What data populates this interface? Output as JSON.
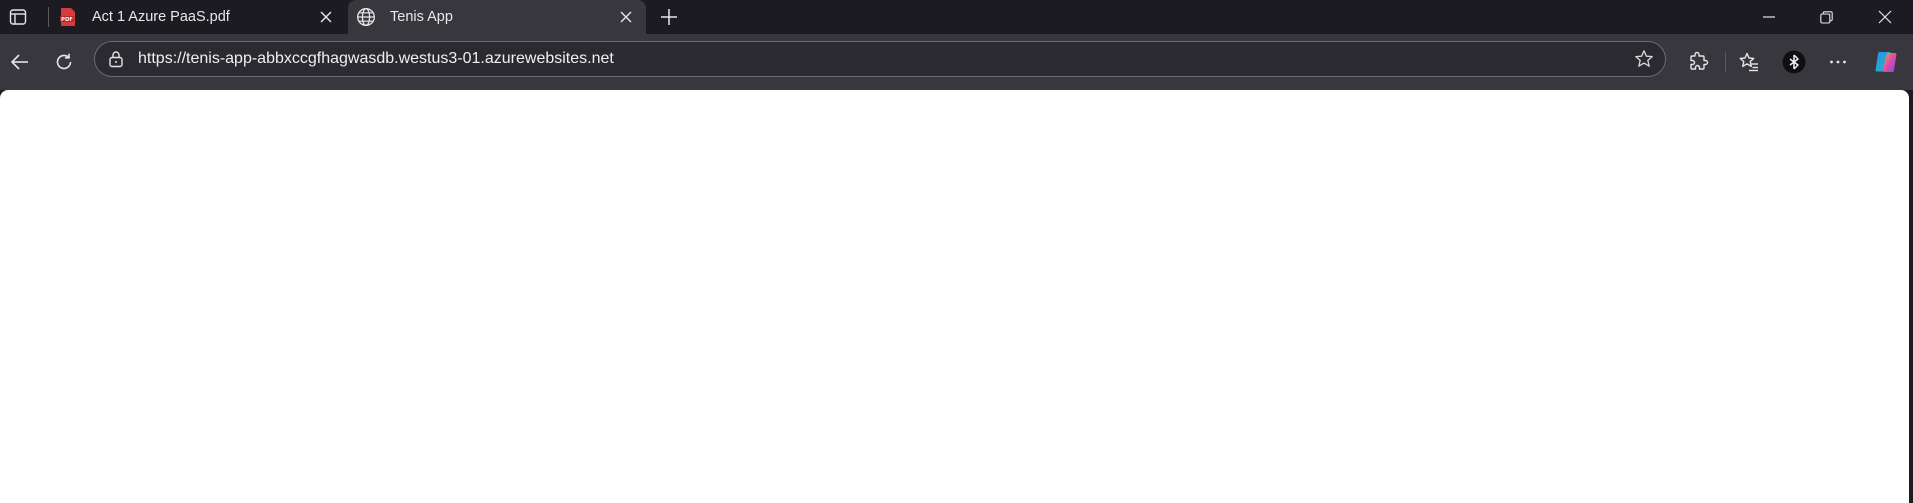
{
  "browser": {
    "tabs": [
      {
        "title": "Act 1 Azure PaaS.pdf",
        "icon": "pdf-icon",
        "active": false
      },
      {
        "title": "Tenis App",
        "icon": "globe-icon",
        "active": true
      }
    ],
    "address_bar": {
      "url": "https://tenis-app-abbxccgfhagwasdb.westus3-01.azurewebsites.net"
    },
    "toolbar_icons": [
      "back-arrow-icon",
      "reload-icon",
      "lock-icon",
      "star-icon",
      "extensions-icon",
      "favorites-icon",
      "bluesky-icon",
      "more-icon",
      "copilot-icon"
    ],
    "colors": {
      "frame": "#1c1b22",
      "toolbar": "#38373d",
      "content": "#ffffff",
      "pdf_red": "#d83b3b"
    }
  },
  "page": {}
}
